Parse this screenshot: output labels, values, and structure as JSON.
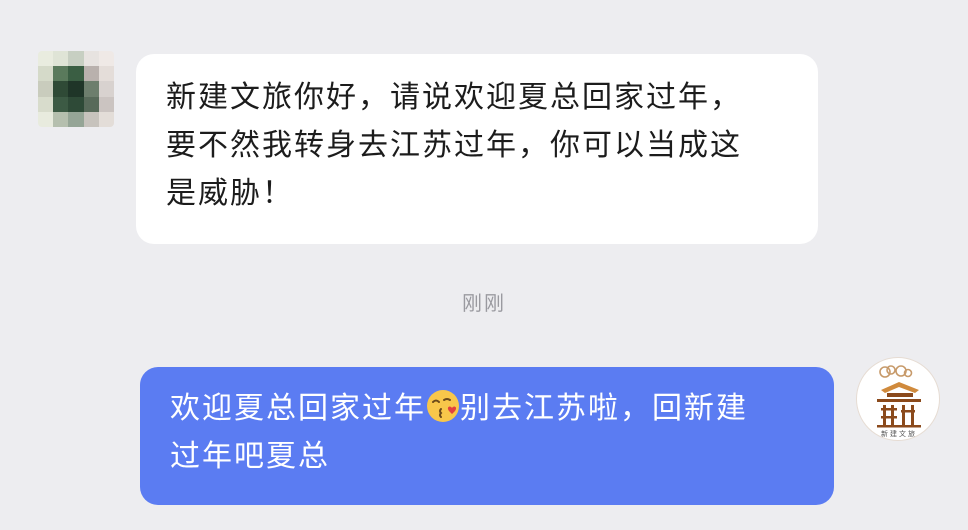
{
  "chat": {
    "incoming": {
      "lines": [
        "新建文旅你好，请说欢迎夏总回家过年，",
        "要不然我转身去江苏过年，你可以当成这",
        "是威胁！"
      ]
    },
    "timestamp": "刚刚",
    "outgoing": {
      "line1_before_emoji": "欢迎夏总回家过年",
      "emoji": "face-blowing-kiss-emoji",
      "line1_after_emoji": "别去江苏啦，回新建",
      "line2": "过年吧夏总"
    },
    "sender_avatar": {
      "icon": "pixelated-avatar"
    },
    "self_avatar": {
      "icon": "xinjian-culture-tourism-logo",
      "logo_text": "新建文旅"
    }
  },
  "colors": {
    "background": "#ededf0",
    "incoming_bubble": "#ffffff",
    "outgoing_bubble": "#5b7cf2",
    "timestamp_text": "#9a9aa0",
    "logo_brown": "#8b4a1c"
  }
}
